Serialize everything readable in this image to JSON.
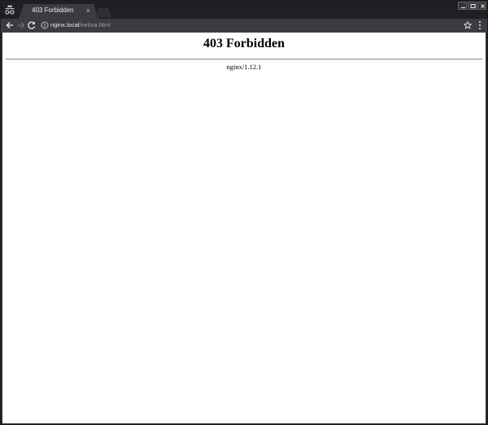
{
  "browser": {
    "tab": {
      "title": "403 Forbidden",
      "close": "×"
    },
    "address": {
      "host": "nginx.local",
      "path": "/velma.html"
    }
  },
  "page": {
    "heading": "403 Forbidden",
    "server": "nginx/1.12.1"
  }
}
